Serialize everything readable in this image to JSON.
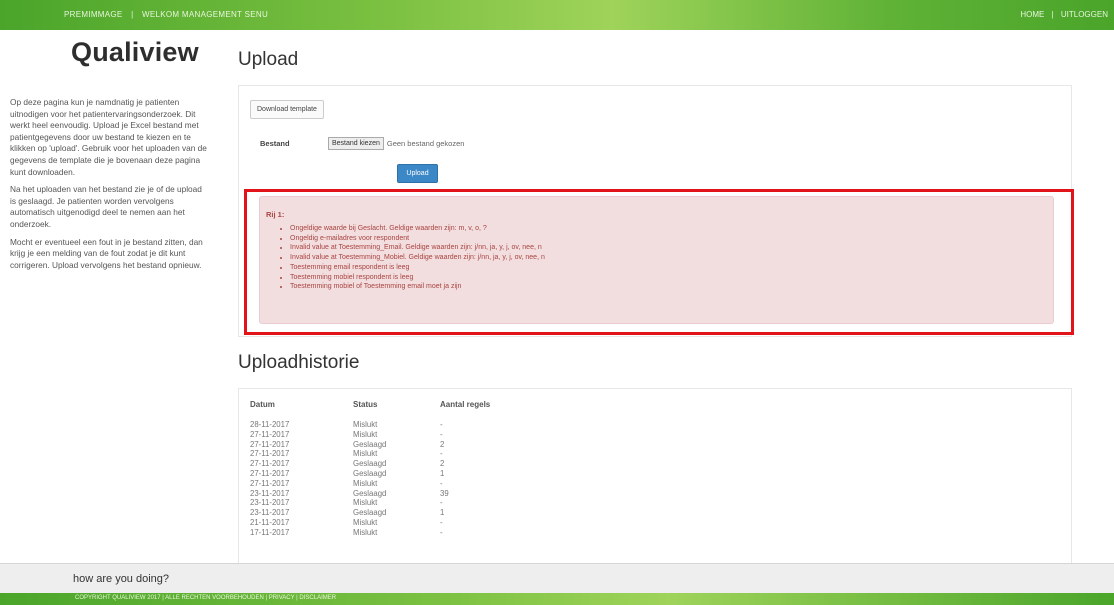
{
  "topbar": {
    "left_items": [
      "PREMIMMAGE",
      "|",
      "WELKOM MANAGEMENT SENU"
    ],
    "right_items": [
      "HOME",
      "|",
      "UITLOGGEN"
    ]
  },
  "logo": "Qualiview",
  "sidebar": {
    "paragraphs": [
      "Op deze pagina kun je namdnatig je patienten uitnodigen voor het patientervaringsonderzoek. Dit werkt heel eenvoudig. Upload je Excel bestand met patientgegevens door uw bestand te kiezen en te klikken op 'upload'. Gebruik voor het uploaden van de gegevens de template die je bovenaan deze pagina kunt downloaden.",
      "Na het uploaden van het bestand zie je of de upload is geslaagd. Je patienten worden vervolgens automatisch uitgenodigd deel te nemen aan het onderzoek.",
      "Mocht er eventueel een fout in je bestand zitten, dan krijg je een melding van de fout zodat je dit kunt corrigeren. Upload vervolgens het bestand opnieuw."
    ]
  },
  "upload": {
    "heading": "Upload",
    "download_template_label": "Download template",
    "bestand_label": "Bestand",
    "file_button_label": "Bestand kiezen",
    "file_none_label": "Geen bestand gekozen",
    "upload_button_label": "Upload"
  },
  "alert": {
    "title": "Rij 1:",
    "items": [
      "Ongeldige waarde bij Geslacht. Geldige waarden zijn: m, v, o, ?",
      "Ongeldig e-mailadres voor respondent",
      "Invalid value at Toestemming_Email. Geldige waarden zijn: j/nn, ja, y, j, ov, nee, n",
      "Invalid value at Toestemming_Mobiel. Geldige waarden zijn: j/nn, ja, y, j, ov, nee, n",
      "Toestemming email respondent is leeg",
      "Toestemming mobiel respondent is leeg",
      "Toestemming mobiel of Toestemming email moet ja zijn"
    ]
  },
  "history": {
    "heading": "Uploadhistorie",
    "columns": [
      "Datum",
      "Status",
      "Aantal regels"
    ],
    "rows": [
      [
        "28-11-2017",
        "Mislukt",
        "-"
      ],
      [
        "27-11-2017",
        "Mislukt",
        "-"
      ],
      [
        "27-11-2017",
        "Geslaagd",
        "2"
      ],
      [
        "27-11-2017",
        "Mislukt",
        "-"
      ],
      [
        "27-11-2017",
        "Geslaagd",
        "2"
      ],
      [
        "27-11-2017",
        "Geslaagd",
        "1"
      ],
      [
        "27-11-2017",
        "Mislukt",
        "-"
      ],
      [
        "23-11-2017",
        "Geslaagd",
        "39"
      ],
      [
        "23-11-2017",
        "Mislukt",
        "-"
      ],
      [
        "23-11-2017",
        "Geslaagd",
        "1"
      ],
      [
        "21-11-2017",
        "Mislukt",
        "-"
      ],
      [
        "17-11-2017",
        "Mislukt",
        "-"
      ]
    ]
  },
  "feedback_bar": "how are you doing?",
  "footer_text": "COPYRIGHT QUALIVIEW 2017 | ALLE RECHTEN VOORBEHOUDEN | PRIVACY | DISCLAIMER"
}
